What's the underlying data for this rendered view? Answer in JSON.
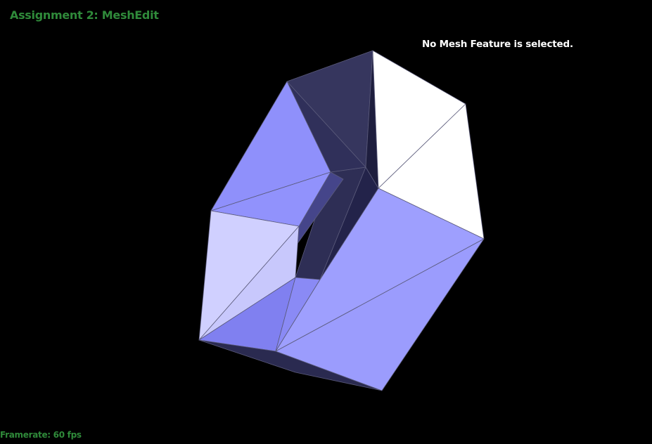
{
  "app": {
    "title": "Assignment 2: MeshEdit"
  },
  "overlay": {
    "selection_status": "No Mesh Feature is selected."
  },
  "stats": {
    "framerate_label": "Framerate:",
    "framerate_value": "60 fps"
  },
  "colors": {
    "background": "#000000",
    "hud_text": "#2f8a3a",
    "status_text": "#ffffff",
    "face_lit": "#9fa0ff",
    "face_light": "#d0d0ff",
    "face_dark": "#383866",
    "face_white": "#ffffff"
  }
}
